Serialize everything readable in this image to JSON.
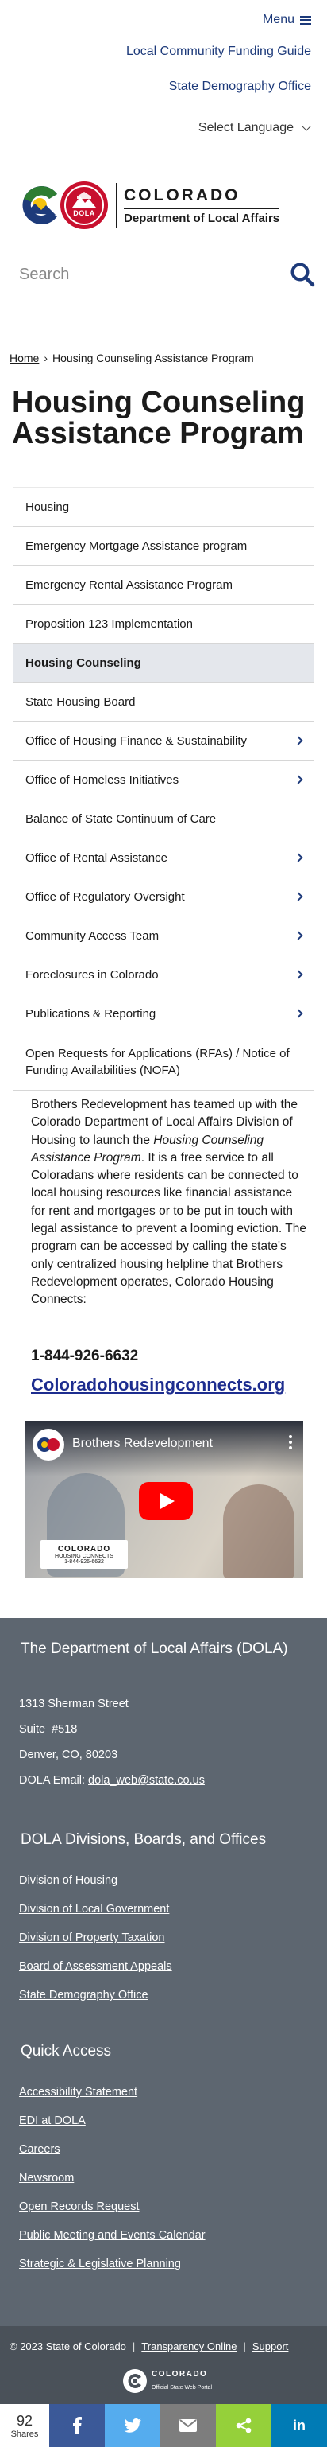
{
  "utility": {
    "menu_label": "Menu",
    "links": [
      "Local Community Funding Guide",
      "State Demography Office"
    ],
    "language_label": "Select Language"
  },
  "logo": {
    "state": "COLORADO",
    "department": "Department of Local Affairs",
    "seal_text": "DOLA"
  },
  "search": {
    "placeholder": "Search"
  },
  "breadcrumb": {
    "home": "Home",
    "separator": "›",
    "current": "Housing Counseling Assistance Program"
  },
  "page_title": "Housing Counseling Assistance Program",
  "side_nav": [
    {
      "label": "Housing",
      "arrow": false,
      "active": false
    },
    {
      "label": "Emergency Mortgage Assistance program",
      "arrow": false,
      "active": false
    },
    {
      "label": "Emergency Rental Assistance Program",
      "arrow": false,
      "active": false
    },
    {
      "label": "Proposition 123 Implementation",
      "arrow": false,
      "active": false
    },
    {
      "label": "Housing Counseling",
      "arrow": false,
      "active": true
    },
    {
      "label": "State Housing Board",
      "arrow": false,
      "active": false
    },
    {
      "label": "Office of Housing Finance & Sustainability",
      "arrow": true,
      "active": false
    },
    {
      "label": "Office of Homeless Initiatives",
      "arrow": true,
      "active": false
    },
    {
      "label": "Balance of State Continuum of Care",
      "arrow": false,
      "active": false
    },
    {
      "label": "Office of Rental Assistance",
      "arrow": true,
      "active": false
    },
    {
      "label": "Office of Regulatory Oversight",
      "arrow": true,
      "active": false
    },
    {
      "label": "Community Access Team",
      "arrow": true,
      "active": false
    },
    {
      "label": "Foreclosures in Colorado",
      "arrow": true,
      "active": false
    },
    {
      "label": "Publications & Reporting",
      "arrow": true,
      "active": false
    },
    {
      "label": "Open Requests for Applications (RFAs) / Notice of Funding Availabilities (NOFA)",
      "arrow": false,
      "active": false
    }
  ],
  "content": {
    "p1_a": "Brothers Redevelopment has teamed up with the Colorado Department of Local Affairs Division of Housing to launch the ",
    "p1_em": "Housing Counseling Assistance Program",
    "p1_b": ". It is a free service to all Coloradans where residents can be connected to local housing resources like financial assistance for rent and mortgages or to be put in touch with legal assistance to prevent a looming eviction. The program can be accessed by calling the state's only centralized housing helpline that Brothers Redevelopment operates, Colorado Housing Connects:",
    "phone": "1-844-926-6632",
    "site_link": "Coloradohousingconnects.org"
  },
  "video": {
    "title": "Brothers Redevelopment",
    "badge_name": "COLORADO",
    "badge_sub": "HOUSING CONNECTS",
    "badge_phone": "1-844-926-6632"
  },
  "footer": {
    "dola_heading": "The Department of Local Affairs (DOLA)",
    "address_line1": "1313 Sherman Street",
    "address_line2": "Suite  #518",
    "address_line3": "Denver, CO, 80203",
    "email_label": "DOLA Email: ",
    "email": "dola_web@state.co.us",
    "divisions_heading": "DOLA Divisions, Boards, and Offices",
    "divisions": [
      "Division of Housing",
      "Division of Local Government",
      "Division of Property Taxation",
      "Board of Assessment Appeals",
      "State Demography Office"
    ],
    "quick_heading": "Quick Access",
    "quick_links": [
      "Accessibility Statement",
      "EDI at DOLA",
      "Careers",
      "Newsroom",
      "Open Records Request",
      "Public Meeting and Events Calendar",
      "Strategic & Legislative Planning"
    ]
  },
  "sub_footer": {
    "copyright": "© 2023 State of Colorado",
    "links": [
      "Transparency Online",
      "Support"
    ],
    "separator": "|",
    "portal_name": "COLORADO",
    "portal_sub": "Official State Web Portal"
  },
  "share_bar": {
    "count": "92",
    "count_label": "Shares",
    "buttons": [
      "facebook-icon",
      "twitter-icon",
      "email-icon",
      "share-icon",
      "linkedin-icon"
    ],
    "linkedin_text": "in"
  },
  "colors": {
    "brand_blue": "#1d3a7a",
    "footer_bg": "#5d6670",
    "sub_footer_bg": "#4a5159",
    "active_nav": "#e4e7ec"
  }
}
